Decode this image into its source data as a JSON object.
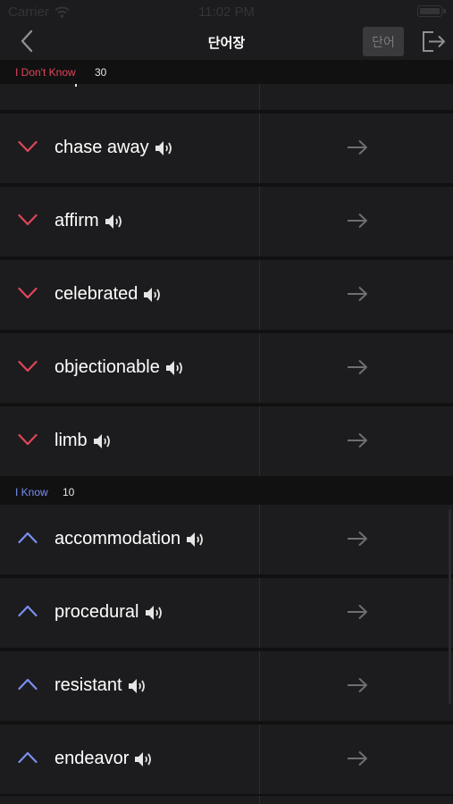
{
  "status_bar": {
    "carrier": "Carrier",
    "time": "11:02 PM"
  },
  "nav": {
    "title": "단어장",
    "word_button": "단어"
  },
  "sections": {
    "unknown": {
      "label": "I Don't Know",
      "count": "30",
      "color": "#e0455a"
    },
    "known": {
      "label": "I Know",
      "count": "10",
      "color": "#7b8ff0"
    }
  },
  "unknown_words": [
    "chase away",
    "affirm",
    "celebrated",
    "objectionable",
    "limb"
  ],
  "known_words": [
    "accommodation",
    "procedural",
    "resistant",
    "endeavor"
  ],
  "icons": {
    "back": "chevron-left-icon",
    "exit": "exit-icon",
    "speaker": "speaker-icon",
    "expand": "chevron-down-icon",
    "collapse": "chevron-up-icon",
    "detail": "arrow-right-icon"
  }
}
